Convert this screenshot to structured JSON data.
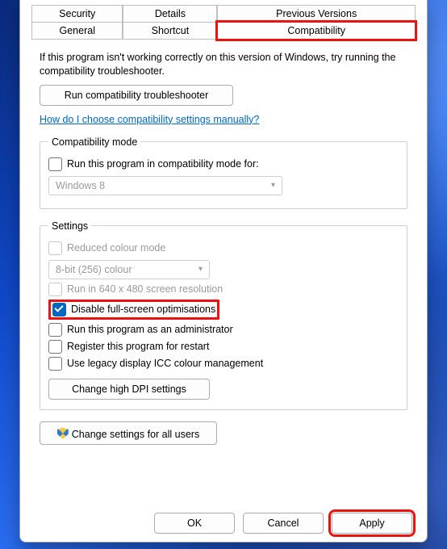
{
  "tabs": {
    "row1": [
      "Security",
      "Details",
      "Previous Versions"
    ],
    "row2": [
      "General",
      "Shortcut",
      "Compatibility"
    ],
    "active": "Compatibility"
  },
  "intro": "If this program isn't working correctly on this version of Windows, try running the compatibility troubleshooter.",
  "troubleshooterButton": "Run compatibility troubleshooter",
  "helpLink": "How do I choose compatibility settings manually?",
  "compatMode": {
    "legend": "Compatibility mode",
    "checkboxLabel": "Run this program in compatibility mode for:",
    "checked": false,
    "selectValue": "Windows 8",
    "selectEnabled": false
  },
  "settings": {
    "legend": "Settings",
    "reducedColour": {
      "label": "Reduced colour mode",
      "checked": false,
      "enabled": false
    },
    "colourSelect": {
      "value": "8-bit (256) colour",
      "enabled": false
    },
    "run640": {
      "label": "Run in 640 x 480 screen resolution",
      "checked": false,
      "enabled": false
    },
    "disableFSO": {
      "label": "Disable full-screen optimisations",
      "checked": true,
      "enabled": true
    },
    "runAsAdmin": {
      "label": "Run this program as an administrator",
      "checked": false,
      "enabled": true
    },
    "registerRestart": {
      "label": "Register this program for restart",
      "checked": false,
      "enabled": true
    },
    "legacyICC": {
      "label": "Use legacy display ICC colour management",
      "checked": false,
      "enabled": true
    },
    "dpiButton": "Change high DPI settings"
  },
  "allUsersButton": "Change settings for all users",
  "footer": {
    "ok": "OK",
    "cancel": "Cancel",
    "apply": "Apply"
  }
}
